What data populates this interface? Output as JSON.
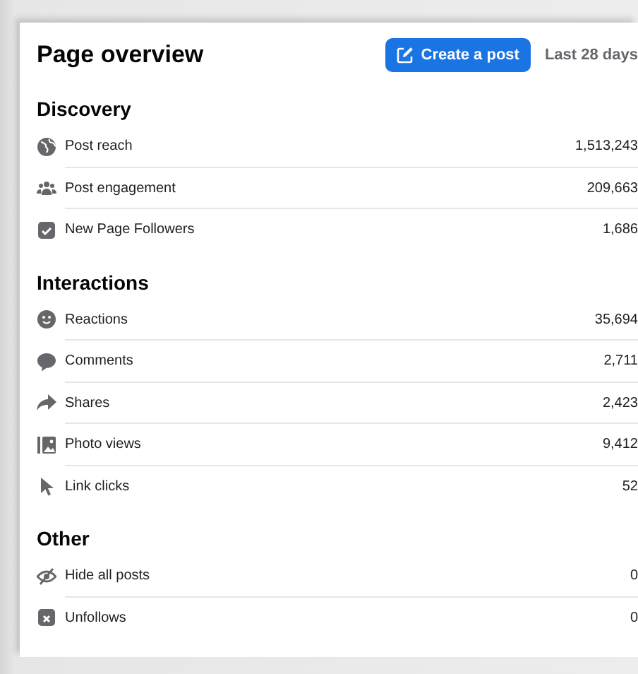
{
  "header": {
    "title": "Page overview",
    "create_button": "Create a post",
    "period": "Last 28 days"
  },
  "sections": [
    {
      "title": "Discovery",
      "rows": [
        {
          "kind": "globe",
          "label": "Post reach",
          "value": "1,513,243"
        },
        {
          "kind": "people",
          "label": "Post engagement",
          "value": "209,663"
        },
        {
          "kind": "follow",
          "label": "New Page Followers",
          "value": "1,686"
        }
      ]
    },
    {
      "title": "Interactions",
      "rows": [
        {
          "kind": "smiley",
          "label": "Reactions",
          "value": "35,694"
        },
        {
          "kind": "comment",
          "label": "Comments",
          "value": "2,711"
        },
        {
          "kind": "share",
          "label": "Shares",
          "value": "2,423"
        },
        {
          "kind": "photo",
          "label": "Photo views",
          "value": "9,412"
        },
        {
          "kind": "cursor",
          "label": "Link clicks",
          "value": "52"
        }
      ]
    },
    {
      "title": "Other",
      "rows": [
        {
          "kind": "hide",
          "label": "Hide all posts",
          "value": "0"
        },
        {
          "kind": "unfollow",
          "label": "Unfollows",
          "value": "0"
        }
      ]
    }
  ]
}
